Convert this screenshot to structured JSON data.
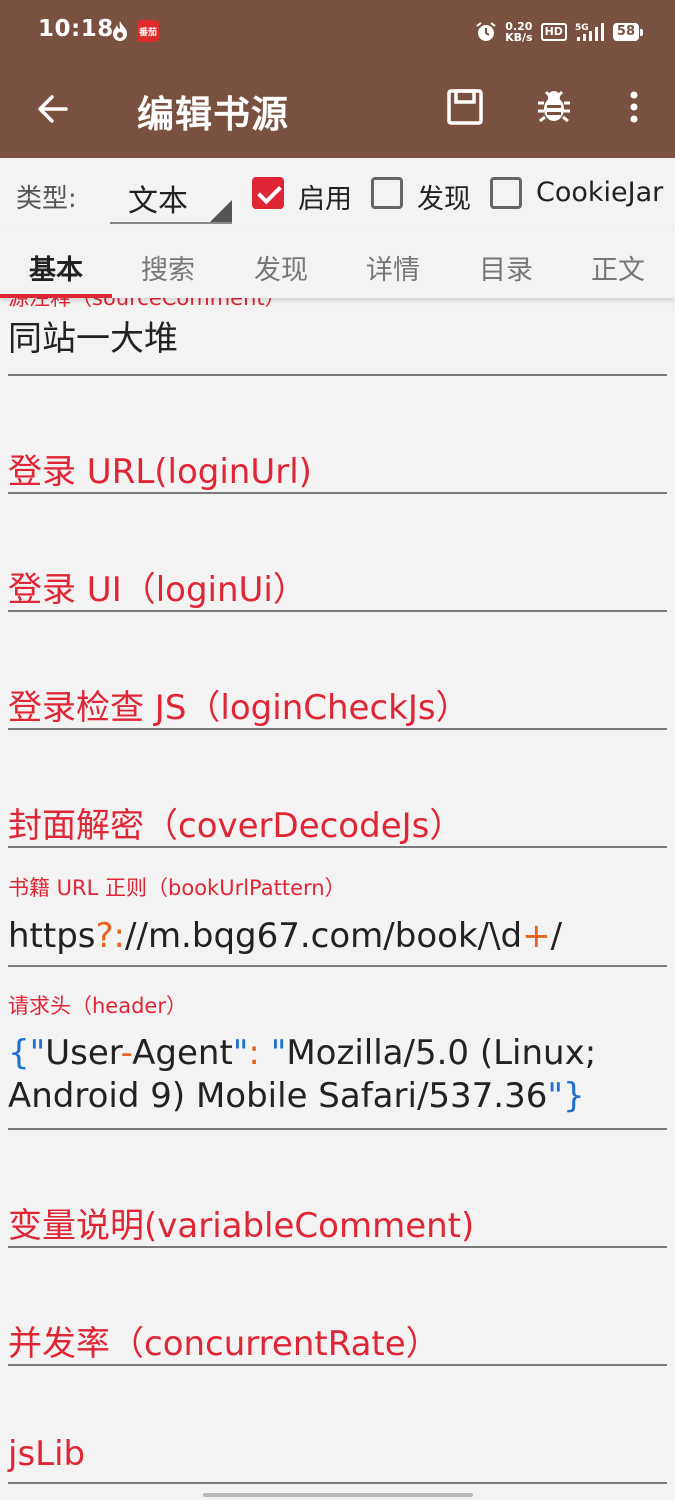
{
  "status": {
    "time": "10:18",
    "app_badge": "番茄",
    "net_speed_value": "0.20",
    "net_speed_unit": "KB/s",
    "hd": "HD",
    "network": "5G",
    "battery": "58"
  },
  "appbar": {
    "title": "编辑书源",
    "back_icon": "arrow-back-icon",
    "save_icon": "save-icon",
    "debug_icon": "bug-icon",
    "more_icon": "more-vert-icon"
  },
  "typerow": {
    "type_label": "类型:",
    "type_value": "文本",
    "checkboxes": [
      {
        "label": "启用",
        "checked": true
      },
      {
        "label": "发现",
        "checked": false
      },
      {
        "label": "CookieJar",
        "checked": false
      }
    ]
  },
  "tabs": [
    "基本",
    "搜索",
    "发现",
    "详情",
    "目录",
    "正文"
  ],
  "active_tab": "基本",
  "fields": {
    "source_comment_label": "源注释（sourceComment）",
    "source_comment_value": "同站一大堆",
    "login_url_hint": "登录 URL(loginUrl)",
    "login_ui_hint": "登录 UI（loginUi）",
    "login_check_hint": "登录检查 JS（loginCheckJs）",
    "cover_decode_hint": "封面解密（coverDecodeJs）",
    "book_url_pattern_label": "书籍 URL 正则（bookUrlPattern）",
    "book_url_pattern": {
      "p1": "https",
      "p2": "?:",
      "p3": "//m.bqg67.com/book/\\d",
      "p4": "+",
      "p5": "/"
    },
    "header_label": "请求头（header）",
    "header_value": {
      "l1_brace": "{",
      "l1_q1": "\"",
      "l1_k1": "User",
      "l1_dash": "-",
      "l1_k2": "Agent",
      "l1_q2": "\"",
      "l1_colon": ":",
      "l1_q3": " \"",
      "l1_v": "Mozilla/5.0 (Linux;",
      "l2_v": "Android 9) Mobile Safari/537.36",
      "l2_q": "\"",
      "l2_brace": "}"
    },
    "variable_comment_hint": "变量说明(variableComment)",
    "concurrent_rate_hint": "并发率（concurrentRate）",
    "jslib_hint": "jsLib"
  },
  "colors": {
    "appbar": "#7a5141",
    "accent": "#e02535",
    "operator": "#e8641e",
    "brace": "#1f6fd1"
  }
}
